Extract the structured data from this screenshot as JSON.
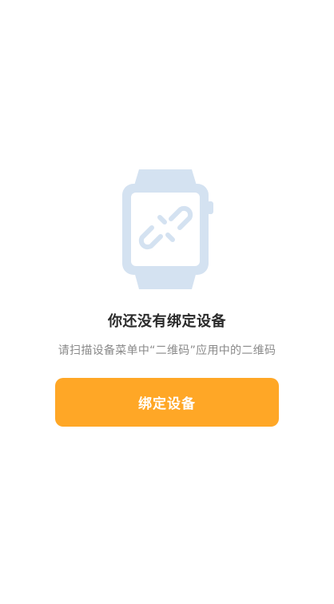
{
  "empty_state": {
    "illustration_icon": "smartwatch-unlinked-icon",
    "title": "你还没有绑定设备",
    "hint": "请扫描设备菜单中“二维码”应用中的二维码"
  },
  "actions": {
    "bind_device_label": "绑定设备"
  },
  "colors": {
    "accent": "#ffa726",
    "illustration": "#d4e2f1"
  }
}
